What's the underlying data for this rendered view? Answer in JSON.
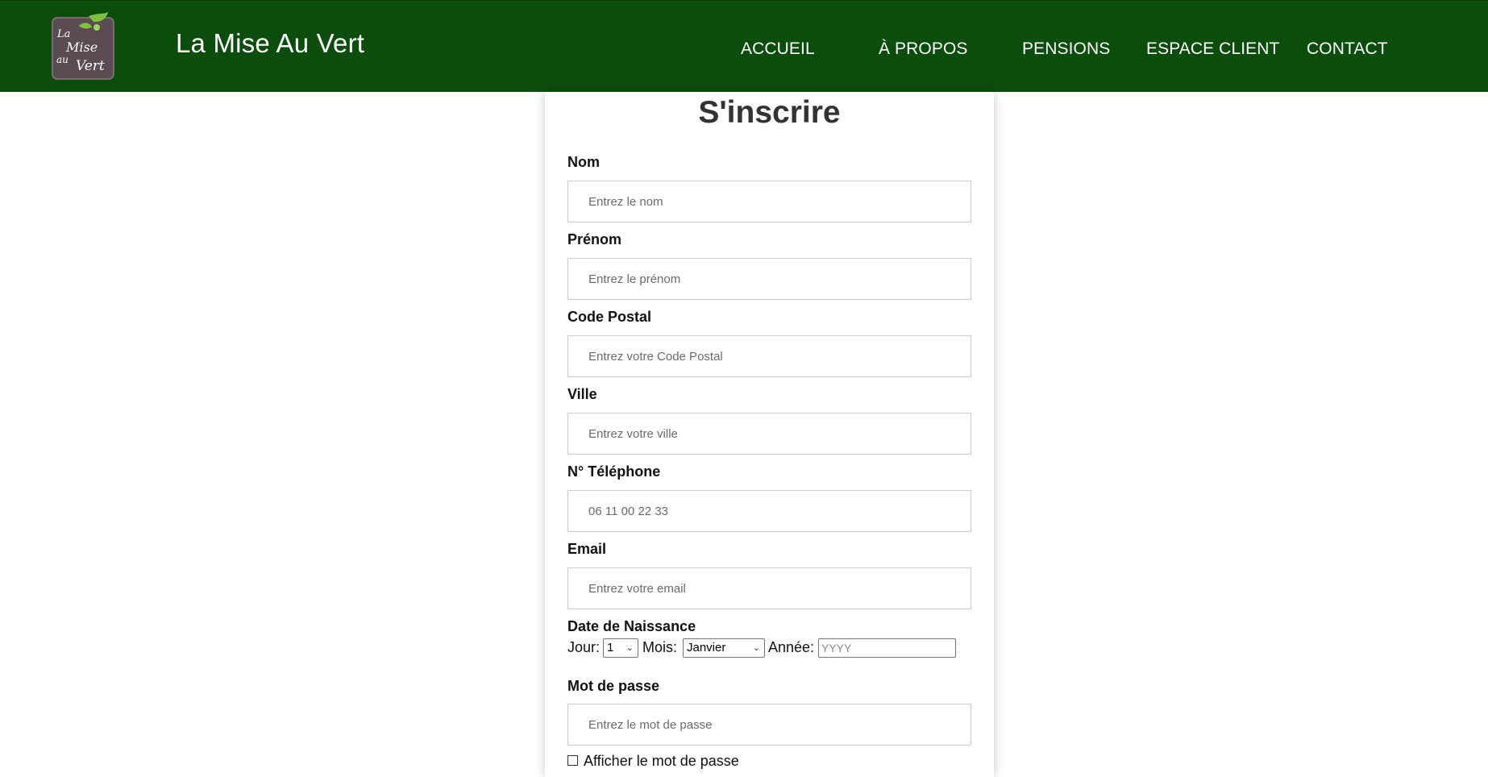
{
  "header": {
    "site_title": "La Mise Au Vert",
    "logo_text": [
      "La",
      "Mise",
      "au",
      "Vert"
    ],
    "nav": {
      "accueil": "ACCUEIL",
      "a_propos": "À PROPOS",
      "pensions": "PENSIONS",
      "espace_client": "ESPACE CLIENT",
      "contact": "CONTACT"
    },
    "background_color": "#0b4d0b"
  },
  "form": {
    "title": "S'inscrire",
    "nom": {
      "label": "Nom",
      "placeholder": "Entrez le nom"
    },
    "prenom": {
      "label": "Prénom",
      "placeholder": "Entrez le prénom"
    },
    "code_postal": {
      "label": "Code Postal",
      "placeholder": "Entrez votre Code Postal"
    },
    "ville": {
      "label": "Ville",
      "placeholder": "Entrez votre ville"
    },
    "telephone": {
      "label": "N° Téléphone",
      "placeholder": "06 11 00 22 33"
    },
    "email": {
      "label": "Email",
      "placeholder": "Entrez votre email"
    },
    "date_naissance": {
      "label": "Date de Naissance",
      "jour_label": "Jour:",
      "jour_value": "1",
      "mois_label": "Mois:",
      "mois_value": "Janvier",
      "annee_label": "Année:",
      "annee_placeholder": "YYYY"
    },
    "mot_de_passe": {
      "label": "Mot de passe",
      "placeholder": "Entrez le mot de passe"
    },
    "show_password": {
      "label": "Afficher le mot de passe",
      "checked": false
    }
  }
}
